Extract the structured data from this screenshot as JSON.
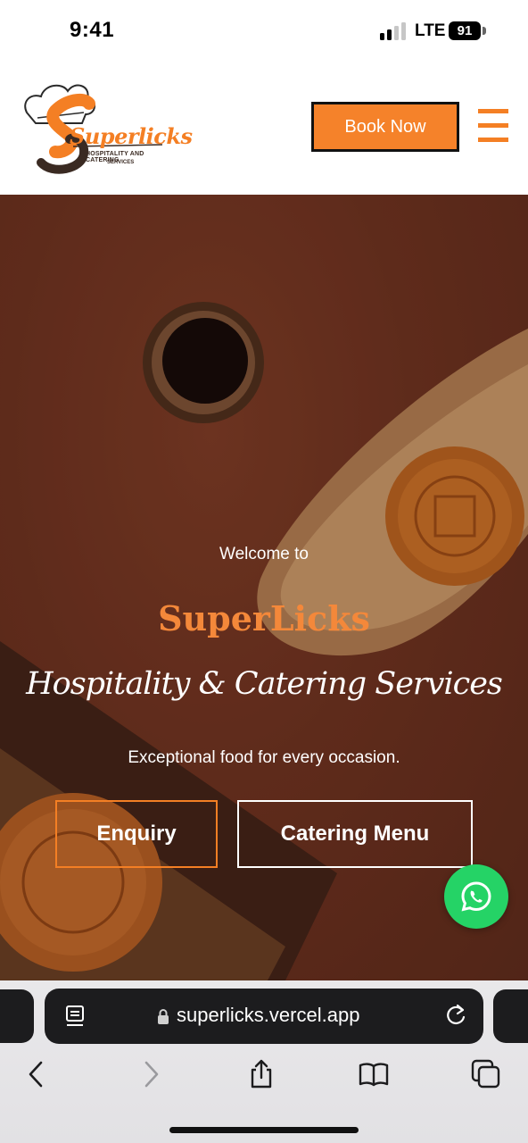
{
  "status_bar": {
    "time": "9:41",
    "network": "LTE",
    "battery": "91"
  },
  "header": {
    "logo": {
      "word": "Superlicks",
      "sub_line1": "HOSPITALITY AND CATERING",
      "sub_line2": "SERVICES"
    },
    "book_button": "Book Now",
    "menu_icon": "hamburger-icon"
  },
  "hero": {
    "welcome": "Welcome to",
    "title": "SuperLicks",
    "script": "Hospitality & Catering Services",
    "tagline": "Exceptional food for every occasion.",
    "enquiry_button": "Enquiry",
    "menu_button": "Catering Menu",
    "whatsapp_icon": "whatsapp-icon"
  },
  "browser": {
    "url": "superlicks.vercel.app",
    "icons": [
      "reader-icon",
      "lock-icon",
      "reload-icon",
      "back-icon",
      "forward-icon",
      "share-icon",
      "bookmarks-icon",
      "tabs-icon"
    ]
  },
  "colors": {
    "accent": "#f47f24",
    "hero_bg": "#6a311f",
    "whatsapp": "#25d366"
  }
}
